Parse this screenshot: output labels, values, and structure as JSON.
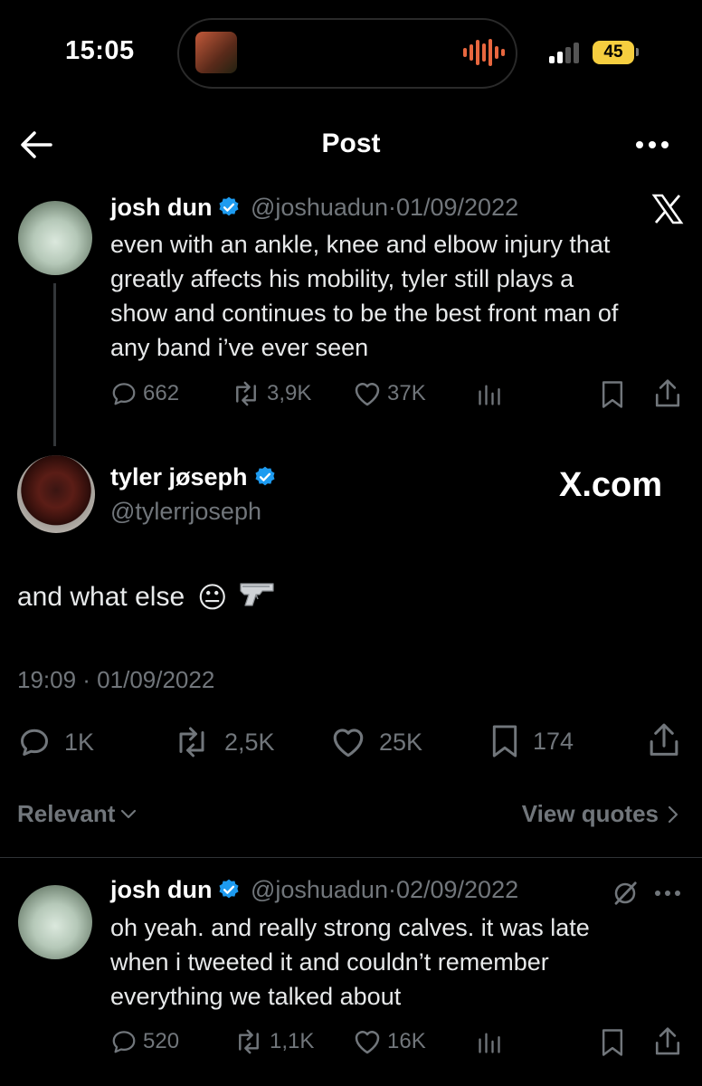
{
  "status_bar": {
    "time": "15:05",
    "battery": "45"
  },
  "header": {
    "title": "Post"
  },
  "parent_tweet": {
    "name": "josh dun",
    "handle": "@joshuadun",
    "date": "01/09/2022",
    "separator": "·",
    "text": [
      "even with an ankle, knee and elbow injury that",
      "greatly affects his mobility, tyler still plays a",
      "show and continues to be the best front man of",
      "any band i’ve ever seen"
    ],
    "replies": "662",
    "reposts": "3,9K",
    "likes": "37K"
  },
  "main_tweet": {
    "name": "tyler jøseph",
    "handle": "@tylerrjoseph",
    "watermark": "X.com",
    "text": "and what else",
    "emoji": "😐",
    "timestamp": "19:09 · 01/09/2022",
    "replies": "1K",
    "reposts": "2,5K",
    "likes": "25K",
    "bookmarks": "174"
  },
  "sort": {
    "label": "Relevant",
    "view_quotes": "View quotes"
  },
  "reply_tweet": {
    "name": "josh dun",
    "handle": "@joshuadun",
    "date": "02/09/2022",
    "separator": "·",
    "text": [
      "oh yeah. and really strong calves. it was late",
      "when i tweeted it and couldn’t remember",
      "everything we talked about"
    ],
    "replies": "520",
    "reposts": "1,1K",
    "likes": "16K"
  },
  "colors": {
    "background": "#000000",
    "text": "#e7e9ea",
    "muted": "#71767b",
    "verified": "#1d9bf0",
    "battery": "#f6ce3f"
  }
}
